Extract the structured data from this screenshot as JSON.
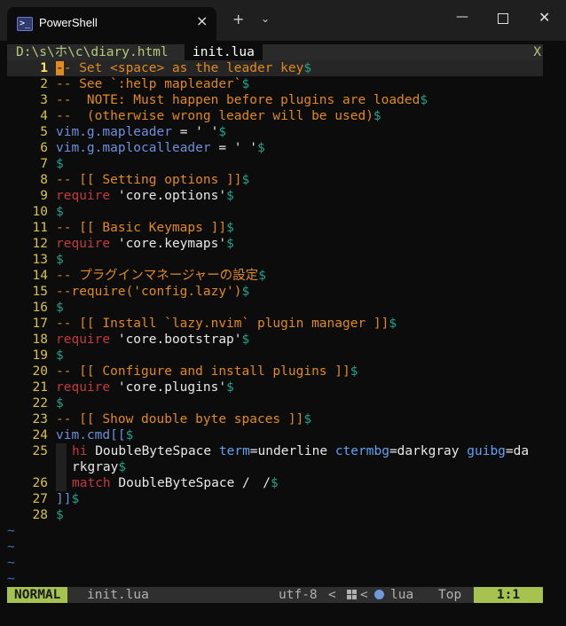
{
  "window": {
    "tab_title": "PowerShell",
    "tab_icon": ">_",
    "tab_close": "×",
    "new_tab": "+",
    "dropdown": "⌄",
    "minimize": "—",
    "close": "✕"
  },
  "tabline": {
    "inactive": "D:\\s\\ホ\\c\\diary.html",
    "active": "init.lua",
    "close": "X"
  },
  "editor": {
    "lines": [
      {
        "n": "1"
      },
      {
        "n": "2"
      },
      {
        "n": "3"
      },
      {
        "n": "4"
      },
      {
        "n": "5"
      },
      {
        "n": "6"
      },
      {
        "n": "7"
      },
      {
        "n": "8"
      },
      {
        "n": "9"
      },
      {
        "n": "10"
      },
      {
        "n": "11"
      },
      {
        "n": "12"
      },
      {
        "n": "13"
      },
      {
        "n": "14"
      },
      {
        "n": "15"
      },
      {
        "n": "16"
      },
      {
        "n": "17"
      },
      {
        "n": "18"
      },
      {
        "n": "19"
      },
      {
        "n": "20"
      },
      {
        "n": "21"
      },
      {
        "n": "22"
      },
      {
        "n": "23"
      },
      {
        "n": "24"
      },
      {
        "n": "25"
      },
      {
        "n": "26"
      },
      {
        "n": "27"
      },
      {
        "n": "28"
      }
    ],
    "text": {
      "l1": "- Set <space> as the leader key",
      "l2": "-- See `:help mapleader`",
      "l3": "--  NOTE: Must happen before plugins are loaded",
      "l4": "--  (otherwise wrong leader will be used)",
      "l5a": "vim",
      "l5b": ".g.mapleader",
      "l5c": " = ' '",
      "l6a": "vim",
      "l6b": ".g.maplocalleader",
      "l6c": " = ' '",
      "l8": "-- [[ Setting options ]]",
      "l9a": "require",
      "l9b": " 'core.options'",
      "l11": "-- [[ Basic Keymaps ]]",
      "l12a": "require",
      "l12b": " 'core.keymaps'",
      "l14": "-- プラグインマネージャーの設定",
      "l15": "--require('config.lazy')",
      "l17": "-- [[ Install `lazy.nvim` plugin manager ]]",
      "l18a": "require",
      "l18b": " 'core.bootstrap'",
      "l20": "-- [[ Configure and install plugins ]]",
      "l21a": "require",
      "l21b": " 'core.plugins'",
      "l23": "-- [[ Show double byte spaces ]]",
      "l24a": "vim",
      "l24b": ".cmd[[",
      "l25a": "hi",
      "l25b": " DoubleByteSpace ",
      "l25c": "term",
      "l25d": "=underline ",
      "l25e": "ctermbg",
      "l25f": "=darkgray ",
      "l25g": "guibg",
      "l25h": "=da",
      "l25i": "rkgray",
      "l26a": "match",
      "l26b": " DoubleByteSpace /　/",
      "l27": "]]",
      "eol": "$",
      "cursor_char": "-",
      "tilde": "~"
    }
  },
  "statusline": {
    "mode": "NORMAL",
    "filename": "init.lua",
    "encoding": "utf-8",
    "sep": "<",
    "filetype": "lua",
    "position": "Top",
    "location": "1:1"
  }
}
